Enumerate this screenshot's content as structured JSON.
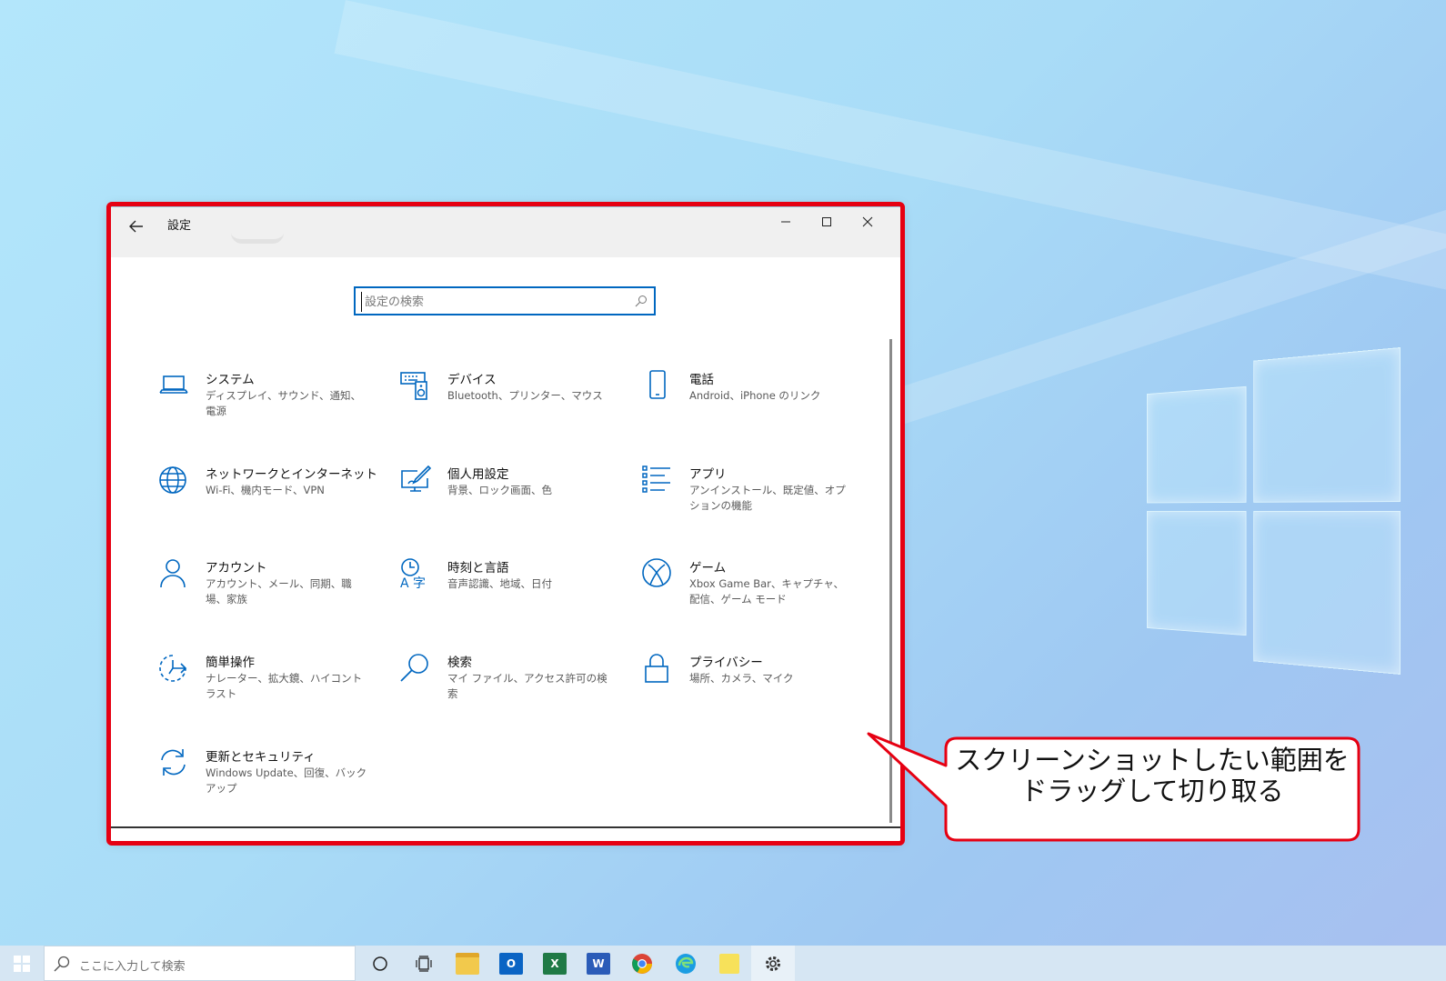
{
  "window": {
    "title": "設定",
    "search_placeholder": "設定の検索"
  },
  "categories": [
    {
      "title": "システム",
      "desc": "ディスプレイ、サウンド、通知、電源",
      "icon": "laptop-icon"
    },
    {
      "title": "デバイス",
      "desc": "Bluetooth、プリンター、マウス",
      "icon": "keyboard-speaker-icon"
    },
    {
      "title": "電話",
      "desc": "Android、iPhone のリンク",
      "icon": "phone-icon"
    },
    {
      "title": "ネットワークとインターネット",
      "desc": "Wi-Fi、機内モード、VPN",
      "icon": "globe-icon"
    },
    {
      "title": "個人用設定",
      "desc": "背景、ロック画面、色",
      "icon": "paintbrush-monitor-icon"
    },
    {
      "title": "アプリ",
      "desc": "アンインストール、既定値、オプションの機能",
      "icon": "app-list-icon"
    },
    {
      "title": "アカウント",
      "desc": "アカウント、メール、同期、職場、家族",
      "icon": "person-icon"
    },
    {
      "title": "時刻と言語",
      "desc": "音声認識、地域、日付",
      "icon": "time-language-icon"
    },
    {
      "title": "ゲーム",
      "desc": "Xbox Game Bar、キャプチャ、配信、ゲーム モード",
      "icon": "xbox-icon"
    },
    {
      "title": "簡単操作",
      "desc": "ナレーター、拡大鏡、ハイコントラスト",
      "icon": "ease-of-access-icon"
    },
    {
      "title": "検索",
      "desc": "マイ ファイル、アクセス許可の検索",
      "icon": "search-icon"
    },
    {
      "title": "プライバシー",
      "desc": "場所、カメラ、マイク",
      "icon": "lock-icon"
    },
    {
      "title": "更新とセキュリティ",
      "desc": "Windows Update、回復、バックアップ",
      "icon": "sync-arrows-icon"
    }
  ],
  "callout": {
    "line1": "スクリーンショットしたい範囲を",
    "line2": "ドラッグして切り取る"
  },
  "taskbar": {
    "search_placeholder": "ここに入力して検索",
    "apps": [
      "start-icon",
      "cortana-icon",
      "task-view-icon",
      "file-explorer-icon",
      "outlook-icon",
      "excel-icon",
      "word-icon",
      "chrome-icon",
      "edge-icon",
      "sticky-notes-icon",
      "settings-gear-icon"
    ]
  },
  "colors": {
    "accent": "#0067c0",
    "highlight_red": "#e60012",
    "desktop": "#aedff8"
  }
}
